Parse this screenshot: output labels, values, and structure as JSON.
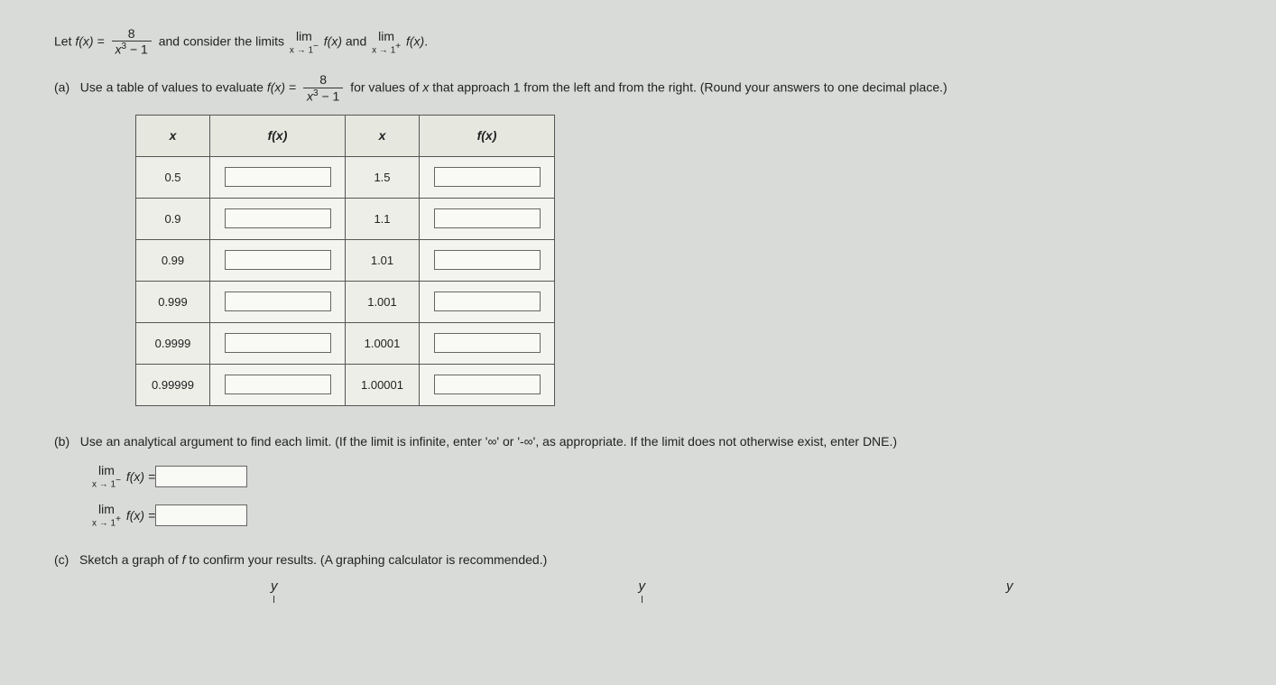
{
  "intro": {
    "let": "Let ",
    "fx_eq": "f(x) = ",
    "frac_num": "8",
    "frac_den_a": "x",
    "frac_den_exp": "3",
    "frac_den_b": " − 1",
    "consider": " and consider the limits ",
    "limword": "lim",
    "approach_left": "x → 1",
    "sup_minus": "−",
    "sup_plus": "+",
    "fx": "f(x)",
    "and": " and ",
    "period": "."
  },
  "part_a": {
    "label": "(a)",
    "text1": "Use a table of values to evaluate ",
    "fx_eq": "f(x) = ",
    "frac_num": "8",
    "frac_den_a": "x",
    "frac_den_exp": "3",
    "frac_den_b": " − 1",
    "text2": " for values of ",
    "x": "x",
    "text3": " that approach 1 from the left and from the right. (Round your answers to one decimal place.)"
  },
  "table": {
    "h_x": "x",
    "h_fx": "f(x)",
    "left_x": [
      "0.5",
      "0.9",
      "0.99",
      "0.999",
      "0.9999",
      "0.99999"
    ],
    "right_x": [
      "1.5",
      "1.1",
      "1.01",
      "1.001",
      "1.0001",
      "1.00001"
    ]
  },
  "part_b": {
    "label": "(b)",
    "text": "Use an analytical argument to find each limit. (If the limit is infinite, enter '∞' or '-∞', as appropriate. If the limit does not otherwise exist, enter DNE.)",
    "limword": "lim",
    "approach": "x → 1",
    "sup_minus": "−",
    "sup_plus": "+",
    "fx_eq": "f(x) = "
  },
  "part_c": {
    "label": "(c)",
    "text": "Sketch a graph of ",
    "f": "f",
    "text2": " to confirm your results. (A graphing calculator is recommended.)",
    "y": "y"
  }
}
